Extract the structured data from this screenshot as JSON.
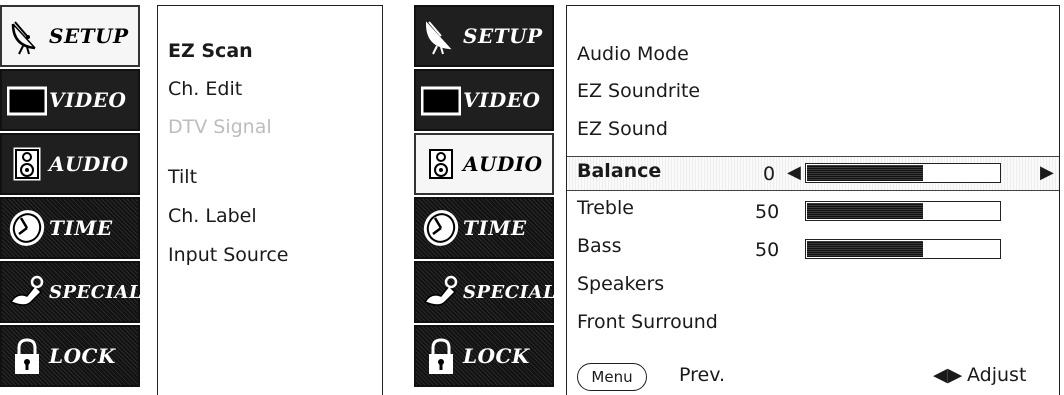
{
  "left_screen": {
    "tabs": [
      {
        "label": "SETUP",
        "icon": "satellite-dish-icon",
        "active": true
      },
      {
        "label": "VIDEO",
        "icon": "screen-icon",
        "active": false
      },
      {
        "label": "AUDIO",
        "icon": "speaker-icon",
        "active": false
      },
      {
        "label": "TIME",
        "icon": "clock-icon",
        "active": false
      },
      {
        "label": "SPECIAL",
        "icon": "special-icon",
        "active": false
      },
      {
        "label": "LOCK",
        "icon": "padlock-icon",
        "active": false
      }
    ],
    "menu": [
      {
        "label": "EZ Scan",
        "selected": true
      },
      {
        "label": "Ch. Edit"
      },
      {
        "label": "DTV Signal",
        "disabled": true
      },
      {
        "label": "Tilt"
      },
      {
        "label": "Ch. Label"
      },
      {
        "label": "Input Source"
      }
    ]
  },
  "right_screen": {
    "tabs": [
      {
        "label": "SETUP",
        "icon": "satellite-dish-icon",
        "active": false
      },
      {
        "label": "VIDEO",
        "icon": "screen-icon",
        "active": false
      },
      {
        "label": "AUDIO",
        "icon": "speaker-icon",
        "active": true
      },
      {
        "label": "TIME",
        "icon": "clock-icon",
        "active": false
      },
      {
        "label": "SPECIAL",
        "icon": "special-icon",
        "active": false
      },
      {
        "label": "LOCK",
        "icon": "padlock-icon",
        "active": false
      }
    ],
    "menu": [
      {
        "label": "Audio Mode"
      },
      {
        "label": "EZ Soundrite"
      },
      {
        "label": "EZ Sound"
      },
      {
        "label": "Balance",
        "selected": true,
        "value": "0",
        "level": 0.6
      },
      {
        "label": "Treble",
        "value": "50",
        "level": 0.6
      },
      {
        "label": "Bass",
        "value": "50",
        "level": 0.6
      },
      {
        "label": "Speakers"
      },
      {
        "label": "Front Surround"
      }
    ],
    "footer": {
      "menu_button": "Menu",
      "prev_label": "Prev.",
      "adjust_label": "Adjust"
    }
  }
}
